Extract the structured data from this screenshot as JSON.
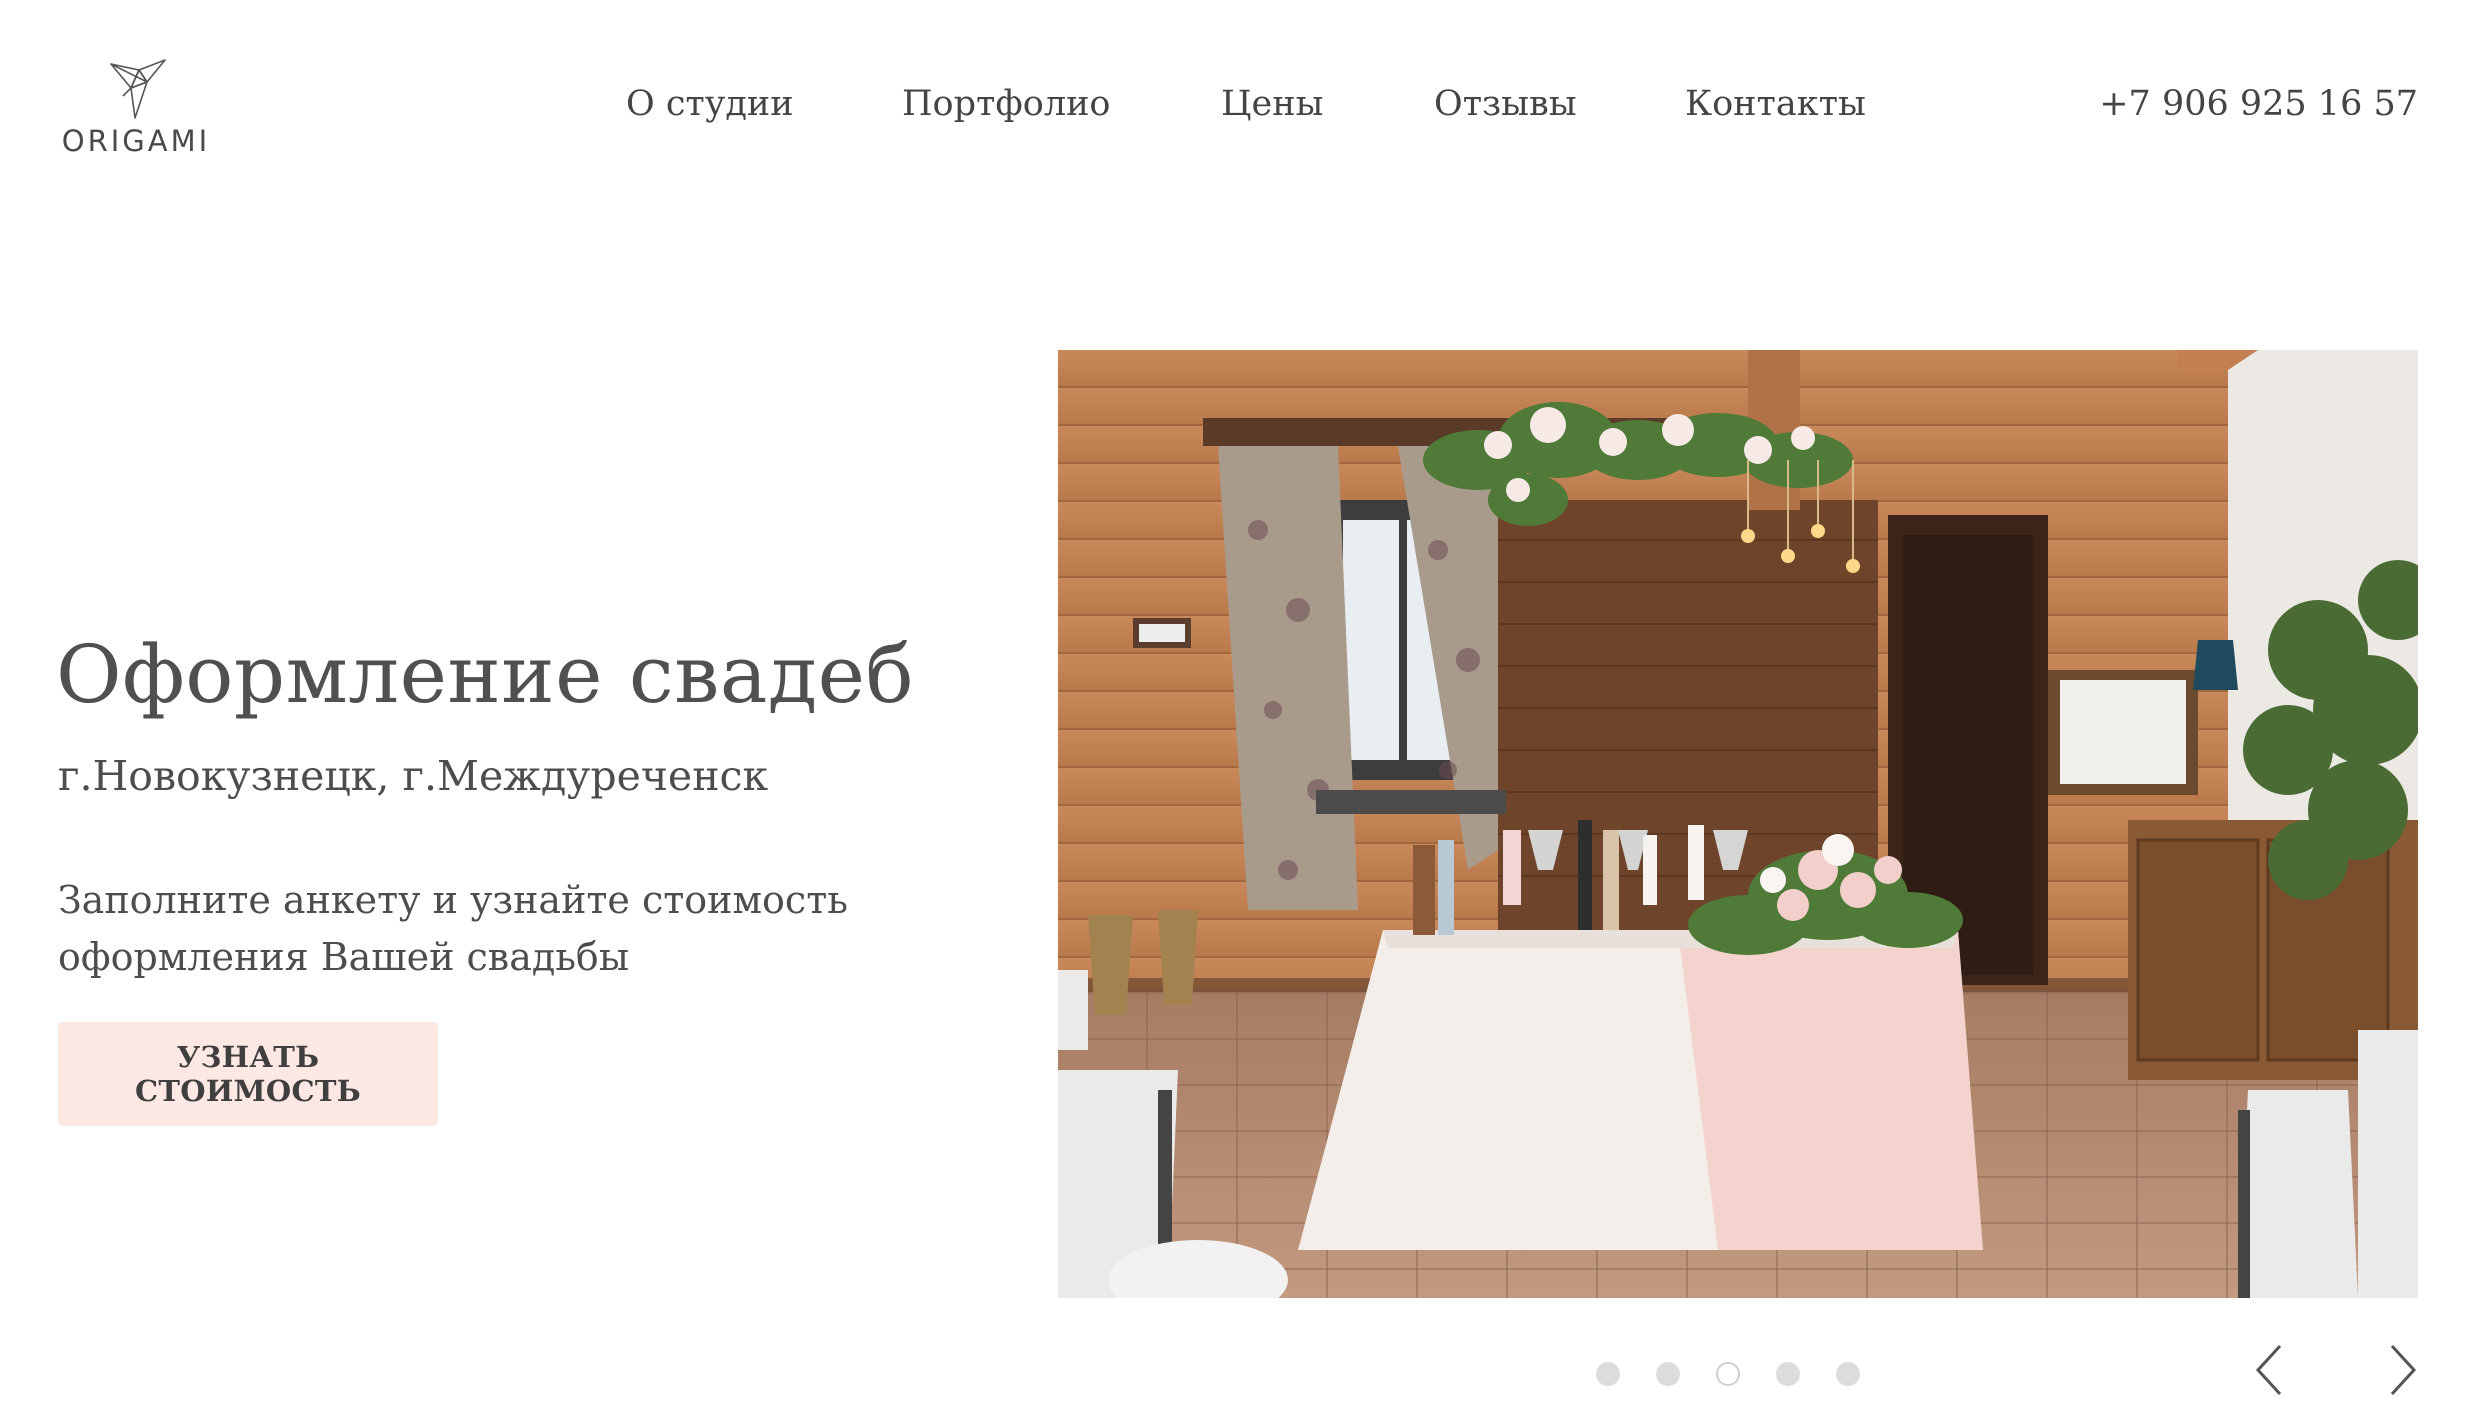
{
  "header": {
    "logo_text": "ORIGAMI",
    "nav": [
      "О студии",
      "Портфолио",
      "Цены",
      "Отзывы",
      "Контакты"
    ],
    "phone": "+7 906 925 16 57"
  },
  "hero": {
    "title": "Оформление свадеб",
    "subtitle": "г.Новокузнецк, г.Междуреченск",
    "description": "Заполните анкету и узнайте стоимость оформления Вашей свадьбы",
    "cta_label": "УЗНАТЬ СТОИМОСТЬ"
  },
  "slider": {
    "slide_count": 5,
    "active_index": 2,
    "prev_icon": "chevron-left-icon",
    "next_icon": "chevron-right-icon"
  },
  "colors": {
    "accent": "#fde8e4",
    "text": "#4d4d4d"
  }
}
